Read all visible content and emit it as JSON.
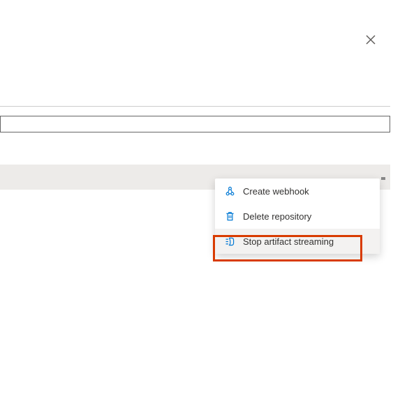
{
  "colors": {
    "highlight": "#d83b01",
    "iconBlue": "#0078d4"
  },
  "menu": {
    "items": [
      {
        "label": "Create webhook",
        "icon": "webhook-icon"
      },
      {
        "label": "Delete repository",
        "icon": "trash-icon"
      },
      {
        "label": "Stop artifact streaming",
        "icon": "stop-stream-icon"
      }
    ]
  }
}
